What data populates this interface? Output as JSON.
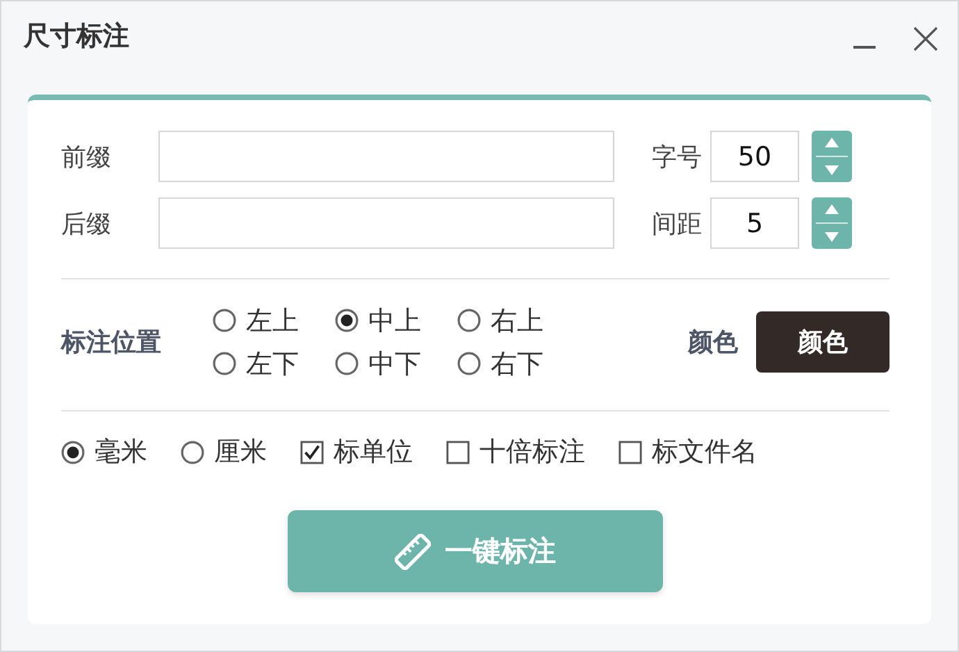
{
  "window": {
    "title": "尺寸标注",
    "controls": [
      {
        "kind": "minimize"
      },
      {
        "kind": "close"
      }
    ]
  },
  "text_fields": [
    {
      "label": "前缀"
    },
    {
      "label": "后缀"
    }
  ],
  "number_fields": [
    {
      "label": "字号",
      "value": "50"
    },
    {
      "label": "间距",
      "value": "5"
    }
  ],
  "position": {
    "label": "标注位置",
    "options": [
      {
        "label": "左上",
        "selected": false
      },
      {
        "label": "中上",
        "selected": true
      },
      {
        "label": "右上",
        "selected": false
      },
      {
        "label": "左下",
        "selected": false
      },
      {
        "label": "中下",
        "selected": false
      },
      {
        "label": "右下",
        "selected": false
      }
    ]
  },
  "color": {
    "label": "颜色",
    "button": "颜色",
    "color": "#332a28"
  },
  "options": [
    {
      "kind": "radio",
      "label": "毫米",
      "selected": true
    },
    {
      "kind": "radio",
      "label": "厘米",
      "selected": false
    },
    {
      "kind": "checkbox",
      "label": "标单位",
      "checked": true
    },
    {
      "kind": "checkbox",
      "label": "十倍标注",
      "checked": false
    },
    {
      "kind": "checkbox",
      "label": "标文件名",
      "checked": false
    }
  ],
  "action": {
    "label": "一键标注"
  }
}
